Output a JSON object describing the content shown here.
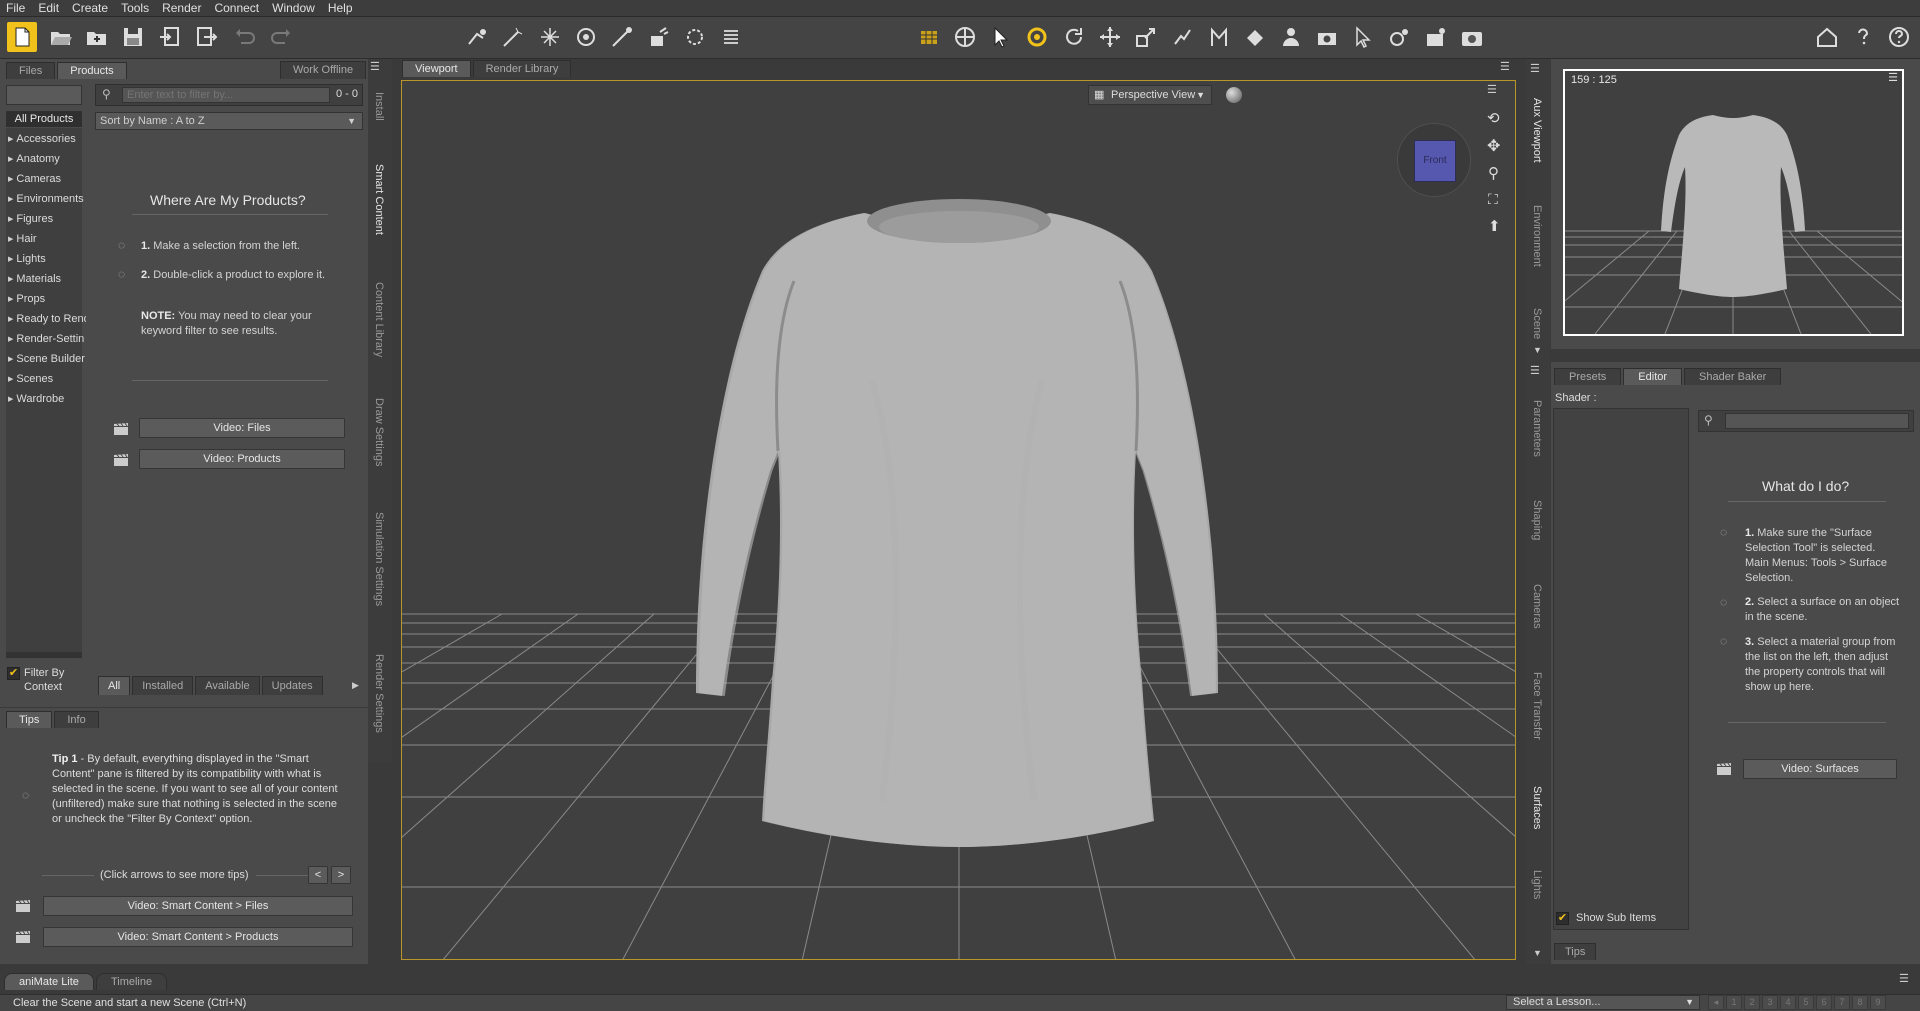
{
  "menu": [
    "File",
    "Edit",
    "Create",
    "Tools",
    "Render",
    "Connect",
    "Window",
    "Help"
  ],
  "left": {
    "tabs": [
      "Files",
      "Products"
    ],
    "work_offline": "Work Offline",
    "filter_placeholder": "Enter text to filter by...",
    "count": "0 - 0",
    "sort": "Sort by Name : A to Z",
    "all_products": "All Products",
    "categories": [
      "Accessories",
      "Anatomy",
      "Cameras",
      "Environments",
      "Figures",
      "Hair",
      "Lights",
      "Materials",
      "Props",
      "Ready to Rend",
      "Render-Settin",
      "Scene Builder",
      "Scenes",
      "Wardrobe"
    ],
    "where_title": "Where Are My Products?",
    "step1_num": "1.",
    "step1": "Make a selection from the left.",
    "step2_num": "2.",
    "step2": "Double-click a product to explore it.",
    "note_label": "NOTE:",
    "note": "You may need to clear your keyword filter to see results.",
    "video_files": "Video: Files",
    "video_products": "Video: Products",
    "filter_by_context": "Filter By Context",
    "bottom_tabs": [
      "All",
      "Installed",
      "Available",
      "Updates"
    ],
    "vtabs": [
      "Install",
      "Smart Content",
      "Content Library",
      "Draw Settings",
      "Simulation Settings",
      "Render Settings"
    ]
  },
  "tips": {
    "tabs": [
      "Tips",
      "Info"
    ],
    "tip_label": "Tip 1",
    "tip_text": " - By default, everything displayed in the \"Smart Content\" pane is filtered by its compatibility with what is selected in the scene. If you want to see all of your content (unfiltered) make sure that nothing is selected in the scene or uncheck the \"Filter By Context\" option.",
    "click_arrows": "(Click arrows to see more tips)",
    "prev": "<",
    "next": ">",
    "video1": "Video: Smart Content > Files",
    "video2": "Video: Smart Content > Products"
  },
  "viewport": {
    "tabs": [
      "Viewport",
      "Render Library"
    ],
    "view_label": "Perspective View",
    "cube_label": "Front"
  },
  "aux": {
    "coords": "159 : 125",
    "vtabs": [
      "Aux Viewport",
      "Environment",
      "Scene"
    ]
  },
  "surfaces": {
    "tabs": [
      "Presets",
      "Editor",
      "Shader Baker"
    ],
    "shader_label": "Shader :",
    "what_title": "What do I do?",
    "s1_num": "1.",
    "s1": "Make sure the \"Surface Selection Tool\" is selected. Main Menus: Tools > Surface Selection.",
    "s2_num": "2.",
    "s2": "Select a surface on an object in the scene.",
    "s3_num": "3.",
    "s3": "Select a material group from the list on the left, then adjust the property controls that will show up here.",
    "video": "Video: Surfaces",
    "show_sub": "Show Sub Items",
    "tips_tab": "Tips",
    "vtabs": [
      "Parameters",
      "Shaping",
      "Cameras",
      "Face Transfer",
      "Surfaces",
      "Lights"
    ]
  },
  "bottom": {
    "tabs": [
      "aniMate Lite",
      "Timeline"
    ],
    "status": "Clear the Scene and start a new Scene (Ctrl+N)",
    "lesson": "Select a Lesson...",
    "pages": [
      "1",
      "2",
      "3",
      "4",
      "5",
      "6",
      "7",
      "8",
      "9"
    ]
  },
  "colors": {
    "accent": "#f1c21b",
    "panel": "#4a4a4a",
    "viewport_bg": "#404040",
    "grid": "#8c8c8c"
  }
}
